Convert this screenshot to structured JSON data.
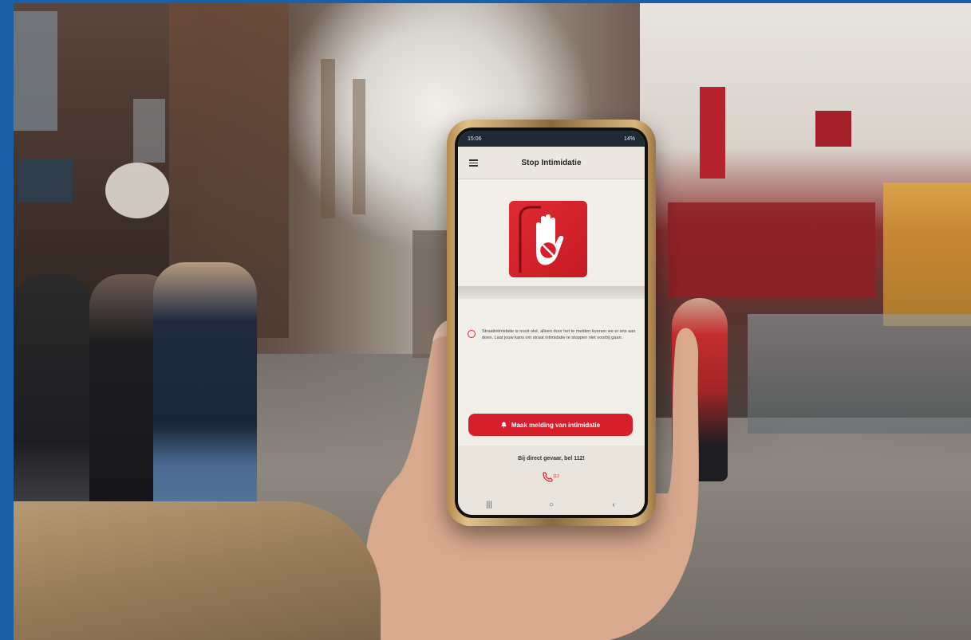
{
  "phone": {
    "status_time": "15:06",
    "status_battery": "14%",
    "app_title": "Stop Intimidatie",
    "info_text": "Straatintimidatie is nooit oké, alleen door het te melden kunnen we er iets aan doen. Laat jouw kans om straat intimidatie te stoppen niet voorbij gaan.",
    "report_button": "Maak melding van intimidatie",
    "danger_text": "Bij direct gevaar, bel 112!",
    "call_label": "112",
    "nav": {
      "recent": "|||",
      "home": "○",
      "back": "‹"
    }
  },
  "colors": {
    "brand_red": "#d61f2b",
    "frame_blue": "#1b5fa8"
  }
}
